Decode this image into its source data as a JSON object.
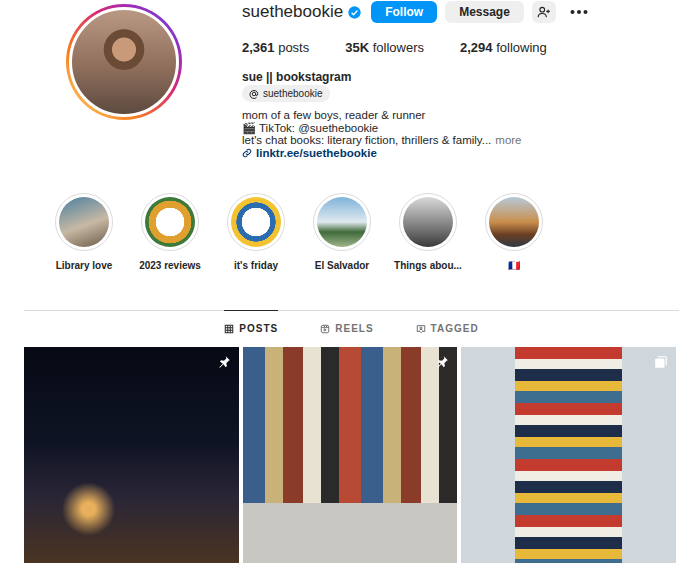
{
  "profile": {
    "username": "suethebookie",
    "verified": true,
    "name": "sue || bookstagram",
    "threads": "suethebookie",
    "bio": [
      "mom of a few boys, reader & runner",
      "🎬 TikTok: @suethebookie",
      "let's chat books: literary fiction, thrillers & family..."
    ],
    "more": "more",
    "link": "linktr.ee/suethebookie"
  },
  "actions": {
    "follow": "Follow",
    "message": "Message"
  },
  "stats": [
    {
      "count": "2,361",
      "label": "posts"
    },
    {
      "count": "35K",
      "label": "followers"
    },
    {
      "count": "2,294",
      "label": "following"
    }
  ],
  "highlights": [
    {
      "label": "Library love"
    },
    {
      "label": "2023 reviews"
    },
    {
      "label": "it's friday"
    },
    {
      "label": "El Salvador"
    },
    {
      "label": "Things abou..."
    },
    {
      "label": "🇫🇷"
    }
  ],
  "tabs": [
    {
      "label": "POSTS",
      "selected": true
    },
    {
      "label": "REELS",
      "selected": false
    },
    {
      "label": "TAGGED",
      "selected": false
    }
  ],
  "posts": [
    {
      "pinned": true,
      "multiple": false
    },
    {
      "pinned": true,
      "multiple": false
    },
    {
      "pinned": false,
      "multiple": true
    }
  ]
}
